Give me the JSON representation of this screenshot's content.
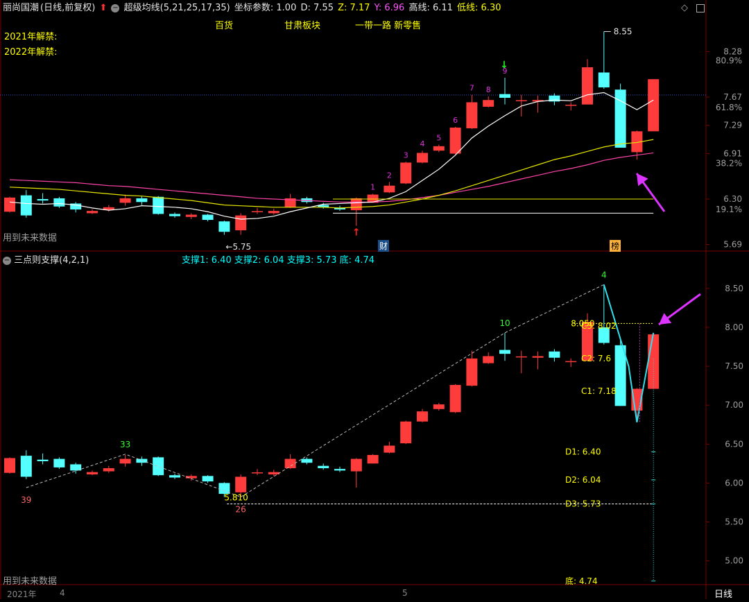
{
  "header": {
    "stock_name": "丽尚国潮",
    "period": "(日线,前复权)",
    "indicator": "超级均线(5,21,25,17,35)",
    "coord_label": "坐标参数: 1.00",
    "d_label": "D: 7.55",
    "z_label": "Z: 7.17",
    "y_label": "Y: 6.96",
    "high_label": "高线: 6.11",
    "low_label": "低线: 6.30",
    "concept_1": "百货",
    "concept_2": "甘肃板块",
    "concept_3": "一带一路 新零售",
    "unlock_2021": "2021年解禁:",
    "unlock_2022": "2022年解禁:"
  },
  "lower_header": {
    "indicator": "三点则支撑(4,2,1)",
    "support_1": "支撑1: 6.40",
    "support_2": "支撑2: 6.04",
    "support_3": "支撑3: 5.73",
    "bottom": "底: 4.74"
  },
  "future_data_label_top": "用到未来数据",
  "future_data_label_bottom": "用到未来数据",
  "cai_badge": "财",
  "bang_badge": "榜",
  "period_button": "日线",
  "x_axis": {
    "year": "2021年",
    "month_4": "4",
    "month_5": "5"
  },
  "colors": {
    "up": "#ff3c3c",
    "down": "#54ffff",
    "ma5": "#ffffff",
    "ma21": "#e8e800",
    "ma25": "#ff44aa",
    "annotation": "#dd33ff",
    "grid": "#7a0000"
  },
  "chart_data": [
    {
      "type": "candlestick",
      "name": "upper",
      "ylim": [
        5.62,
        8.75
      ],
      "y_ticks": [
        {
          "value": 8.28,
          "label": "8.28"
        },
        {
          "value": 7.67,
          "label": "7.67"
        },
        {
          "value": 7.29,
          "label": "7.29"
        },
        {
          "value": 6.91,
          "label": "6.91"
        },
        {
          "value": 6.3,
          "label": "6.30"
        },
        {
          "value": 5.69,
          "label": "5.69"
        }
      ],
      "pct_ticks": [
        {
          "value": 8.16,
          "label": "80.9%"
        },
        {
          "value": 7.53,
          "label": "61.8%"
        },
        {
          "value": 6.78,
          "label": "38.2%"
        },
        {
          "value": 6.16,
          "label": "19.1%"
        }
      ],
      "candles": [
        {
          "o": 6.13,
          "c": 6.32,
          "h": 6.33,
          "l": 6.12
        },
        {
          "o": 6.35,
          "c": 6.08,
          "h": 6.42,
          "l": 6.05
        },
        {
          "o": 6.3,
          "c": 6.28,
          "h": 6.38,
          "l": 6.24
        },
        {
          "o": 6.31,
          "c": 6.2,
          "h": 6.33,
          "l": 6.18
        },
        {
          "o": 6.24,
          "c": 6.16,
          "h": 6.26,
          "l": 6.12
        },
        {
          "o": 6.11,
          "c": 6.14,
          "h": 6.16,
          "l": 6.1
        },
        {
          "o": 6.15,
          "c": 6.19,
          "h": 6.22,
          "l": 6.13
        },
        {
          "o": 6.25,
          "c": 6.31,
          "h": 6.36,
          "l": 6.21
        },
        {
          "o": 6.31,
          "c": 6.26,
          "h": 6.34,
          "l": 6.22
        },
        {
          "o": 6.33,
          "c": 6.1,
          "h": 6.34,
          "l": 6.09
        },
        {
          "o": 6.1,
          "c": 6.07,
          "h": 6.12,
          "l": 6.05
        },
        {
          "o": 6.06,
          "c": 6.09,
          "h": 6.11,
          "l": 6.03
        },
        {
          "o": 6.09,
          "c": 6.02,
          "h": 6.1,
          "l": 6.0
        },
        {
          "o": 6.0,
          "c": 5.86,
          "h": 6.01,
          "l": 5.82
        },
        {
          "o": 5.88,
          "c": 6.08,
          "h": 6.11,
          "l": 5.82
        },
        {
          "o": 6.12,
          "c": 6.13,
          "h": 6.18,
          "l": 6.1
        },
        {
          "o": 6.11,
          "c": 6.14,
          "h": 6.17,
          "l": 6.09
        },
        {
          "o": 6.19,
          "c": 6.31,
          "h": 6.37,
          "l": 6.18
        },
        {
          "o": 6.31,
          "c": 6.26,
          "h": 6.33,
          "l": 6.24
        },
        {
          "o": 6.22,
          "c": 6.19,
          "h": 6.25,
          "l": 6.17
        },
        {
          "o": 6.18,
          "c": 6.16,
          "h": 6.21,
          "l": 6.14
        },
        {
          "o": 6.15,
          "c": 6.31,
          "h": 6.32,
          "l": 5.94
        },
        {
          "o": 6.25,
          "c": 6.36,
          "h": 6.37,
          "l": 6.25
        },
        {
          "o": 6.39,
          "c": 6.48,
          "h": 6.53,
          "l": 6.38
        },
        {
          "o": 6.51,
          "c": 6.79,
          "h": 6.8,
          "l": 6.5
        },
        {
          "o": 6.79,
          "c": 6.92,
          "h": 6.95,
          "l": 6.78
        },
        {
          "o": 6.95,
          "c": 7.01,
          "h": 7.03,
          "l": 6.93
        },
        {
          "o": 6.91,
          "c": 7.26,
          "h": 7.27,
          "l": 6.9
        },
        {
          "o": 7.25,
          "c": 7.6,
          "h": 7.7,
          "l": 7.24
        },
        {
          "o": 7.54,
          "c": 7.63,
          "h": 7.68,
          "l": 7.53
        },
        {
          "o": 7.71,
          "c": 7.66,
          "h": 7.93,
          "l": 7.57
        },
        {
          "o": 7.62,
          "c": 7.62,
          "h": 7.7,
          "l": 7.41
        },
        {
          "o": 7.61,
          "c": 7.63,
          "h": 7.69,
          "l": 7.46
        },
        {
          "o": 7.69,
          "c": 7.61,
          "h": 7.72,
          "l": 7.56
        },
        {
          "o": 7.55,
          "c": 7.56,
          "h": 7.6,
          "l": 7.49
        },
        {
          "o": 7.57,
          "c": 8.07,
          "h": 8.18,
          "l": 7.57
        },
        {
          "o": 8.0,
          "c": 7.8,
          "h": 8.55,
          "l": 7.78
        },
        {
          "o": 7.77,
          "c": 6.99,
          "h": 7.85,
          "l": 6.99
        },
        {
          "o": 6.93,
          "c": 7.21,
          "h": 7.22,
          "l": 6.83
        },
        {
          "o": 7.21,
          "c": 7.91,
          "h": 7.91,
          "l": 7.21
        }
      ],
      "ma5": [
        6.26,
        6.24,
        6.23,
        6.24,
        6.22,
        6.18,
        6.15,
        6.17,
        6.21,
        6.2,
        6.19,
        6.17,
        6.13,
        6.07,
        6.03,
        6.04,
        6.07,
        6.13,
        6.18,
        6.23,
        6.24,
        6.25,
        6.26,
        6.31,
        6.4,
        6.55,
        6.7,
        6.89,
        7.12,
        7.28,
        7.42,
        7.55,
        7.61,
        7.63,
        7.62,
        7.7,
        7.73,
        7.62,
        7.5,
        7.63
      ],
      "ma21": [
        6.46,
        6.45,
        6.44,
        6.43,
        6.41,
        6.39,
        6.37,
        6.35,
        6.34,
        6.32,
        6.3,
        6.28,
        6.25,
        6.22,
        6.21,
        6.2,
        6.19,
        6.19,
        6.19,
        6.19,
        6.18,
        6.19,
        6.2,
        6.22,
        6.26,
        6.3,
        6.35,
        6.41,
        6.48,
        6.55,
        6.62,
        6.69,
        6.76,
        6.83,
        6.88,
        6.94,
        7.0,
        7.04,
        7.06,
        7.1
      ],
      "ma25": [
        6.56,
        6.55,
        6.54,
        6.53,
        6.52,
        6.5,
        6.48,
        6.47,
        6.45,
        6.43,
        6.41,
        6.39,
        6.37,
        6.35,
        6.33,
        6.31,
        6.3,
        6.29,
        6.28,
        6.27,
        6.26,
        6.26,
        6.26,
        6.27,
        6.29,
        6.32,
        6.35,
        6.39,
        6.43,
        6.47,
        6.52,
        6.57,
        6.62,
        6.67,
        6.71,
        6.76,
        6.82,
        6.86,
        6.89,
        6.92
      ],
      "count_labels": [
        {
          "i": 22,
          "text": "1"
        },
        {
          "i": 23,
          "text": "2"
        },
        {
          "i": 24,
          "text": "3"
        },
        {
          "i": 25,
          "text": "4"
        },
        {
          "i": 26,
          "text": "5"
        },
        {
          "i": 27,
          "text": "6"
        },
        {
          "i": 28,
          "text": "7"
        },
        {
          "i": 29,
          "text": "8"
        },
        {
          "i": 30,
          "text": "9"
        }
      ],
      "hlines": [
        {
          "y": 6.3,
          "color": "#e8e800"
        },
        {
          "y": 6.11,
          "color": "#ffffff"
        }
      ],
      "annotations": [
        {
          "text": "8.55",
          "at_index": 36,
          "value": 8.55
        },
        {
          "text": "5.75",
          "at_index": 13,
          "value": 5.75
        }
      ]
    },
    {
      "type": "candlestick",
      "name": "lower",
      "ylim": [
        4.72,
        8.82
      ],
      "y_ticks": [
        {
          "value": 8.5,
          "label": "8.50"
        },
        {
          "value": 8.0,
          "label": "8.00"
        },
        {
          "value": 7.5,
          "label": "7.50"
        },
        {
          "value": 7.0,
          "label": "7.00"
        },
        {
          "value": 6.5,
          "label": "6.50"
        },
        {
          "value": 6.0,
          "label": "6.00"
        },
        {
          "value": 5.5,
          "label": "5.50"
        },
        {
          "value": 5.0,
          "label": "5.00"
        }
      ],
      "candles_same_as": "upper",
      "support_levels": [
        {
          "label": "C3: 8.02",
          "value": 8.02
        },
        {
          "label": "C2: 7.6",
          "value": 7.6
        },
        {
          "label": "C1: 7.18",
          "value": 7.18
        },
        {
          "label": "D1: 6.40",
          "value": 6.4
        },
        {
          "label": "D2: 6.04",
          "value": 6.04
        },
        {
          "label": "D3: 5.73",
          "value": 5.73
        },
        {
          "label": "底: 4.74",
          "value": 4.74
        }
      ],
      "pivot_labels": [
        {
          "i": 1,
          "text": "39",
          "value": 5.94,
          "pos": "below",
          "color": "#ff6666"
        },
        {
          "i": 7,
          "text": "33",
          "value": 6.37,
          "pos": "above",
          "color": "#33ff33"
        },
        {
          "i": 14,
          "text": "26",
          "value": 5.82,
          "pos": "below",
          "color": "#ff6666"
        },
        {
          "i": 30,
          "text": "10",
          "value": 7.93,
          "pos": "above",
          "color": "#33ff33"
        },
        {
          "i": 36,
          "text": "4",
          "value": 8.55,
          "pos": "above",
          "color": "#33ff33"
        }
      ],
      "extra_labels": [
        {
          "text": "8.050",
          "value": 8.05
        },
        {
          "text": "5.810",
          "value": 5.81
        }
      ],
      "dashed_path": [
        {
          "i": 1,
          "v": 5.94
        },
        {
          "i": 7,
          "v": 6.37
        },
        {
          "i": 14,
          "v": 5.82
        },
        {
          "i": 30,
          "v": 7.93
        },
        {
          "i": 36,
          "v": 8.55
        }
      ],
      "zigzag": [
        {
          "i": 36,
          "v": 8.55
        },
        {
          "i": 37.5,
          "v": 7.5
        },
        {
          "i": 38,
          "v": 6.78
        },
        {
          "i": 39,
          "v": 7.93
        }
      ]
    }
  ]
}
